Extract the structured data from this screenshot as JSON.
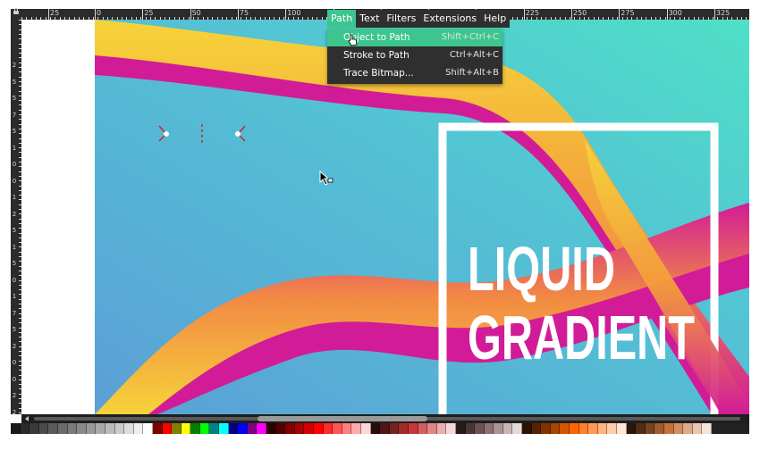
{
  "colors": {
    "menu_bg": "#2f2f2f",
    "menu_highlight": "#3cc58f",
    "ruler_bg": "#2b2b2b",
    "background_gradient_start": "#5b9fd6",
    "background_gradient_end": "#4fe0c6",
    "tube_magenta": "#d21c97",
    "tube_yellow": "#f6d33a",
    "frame_white": "#ffffff"
  },
  "ruler": {
    "horizontal_labels": [
      "25",
      "0",
      "25",
      "50",
      "75",
      "100",
      "125",
      "150",
      "175",
      "200",
      "225",
      "250",
      "275",
      "300",
      "325"
    ],
    "vertical_labels": [
      "2",
      "5",
      "5",
      "7",
      "5",
      "1",
      "0",
      "0",
      "1",
      "2",
      "5",
      "1",
      "5",
      "0",
      "1",
      "7",
      "5",
      "2",
      "0",
      "0",
      "2",
      "2"
    ]
  },
  "menubar": {
    "items": [
      {
        "label": "Path",
        "active": true
      },
      {
        "label": "Text",
        "active": false
      },
      {
        "label": "Filters",
        "active": false
      },
      {
        "label": "Extensions",
        "active": false
      },
      {
        "label": "Help",
        "active": false
      }
    ]
  },
  "path_menu": {
    "items": [
      {
        "label": "Object to Path",
        "shortcut": "Shift+Ctrl+C",
        "highlighted": true
      },
      {
        "label": "Stroke to Path",
        "shortcut": "Ctrl+Alt+C",
        "highlighted": false
      },
      {
        "label": "Trace Bitmap...",
        "shortcut": "Shift+Alt+B",
        "highlighted": false
      }
    ]
  },
  "artwork": {
    "title_line1": "LIQUID",
    "title_line2": "GRADIENT"
  },
  "icons": {
    "cursor": "arrow-pointer-icon",
    "menu_cursor": "hand-pointer-icon",
    "ruler_corner": "lock-icon",
    "scroll_left": "arrow-left-icon",
    "handles": "transform-handle-icon"
  },
  "palette": [
    "#1a1a1a",
    "#2a2a2a",
    "#3a3a3a",
    "#4a4a4a",
    "#5a5a5a",
    "#6a6a6a",
    "#7a7a7a",
    "#8a8a8a",
    "#9a9a9a",
    "#aaaaaa",
    "#bbbbbb",
    "#cccccc",
    "#dddddd",
    "#eeeeee",
    "#ffffff",
    "#800000",
    "#ff0000",
    "#808000",
    "#ffff00",
    "#008000",
    "#00ff00",
    "#008080",
    "#00ffff",
    "#000080",
    "#0000ff",
    "#800080",
    "#ff00ff",
    "#2b0000",
    "#550000",
    "#800000",
    "#aa0000",
    "#d40000",
    "#ff0000",
    "#ff2a2a",
    "#ff5555",
    "#ff8080",
    "#ffaaaa",
    "#ffd5d5",
    "#280b0b",
    "#501616",
    "#782121",
    "#a02c2c",
    "#c83737",
    "#d35f5f",
    "#de8787",
    "#e9afaf",
    "#f4d7d7",
    "#241c1c",
    "#483737",
    "#6c5353",
    "#916f6f",
    "#ac9393",
    "#c8b7b7",
    "#e3dbdb",
    "#2b1100",
    "#552200",
    "#803300",
    "#aa4400",
    "#d45500",
    "#ff6600",
    "#ff7f2a",
    "#ff9955",
    "#ffb380",
    "#ffccaa",
    "#ffe6d5",
    "#28170b",
    "#502d16",
    "#784421",
    "#a05a2c",
    "#c87137",
    "#d38d5f",
    "#deaa87",
    "#e9c6af",
    "#f4e3d7"
  ]
}
